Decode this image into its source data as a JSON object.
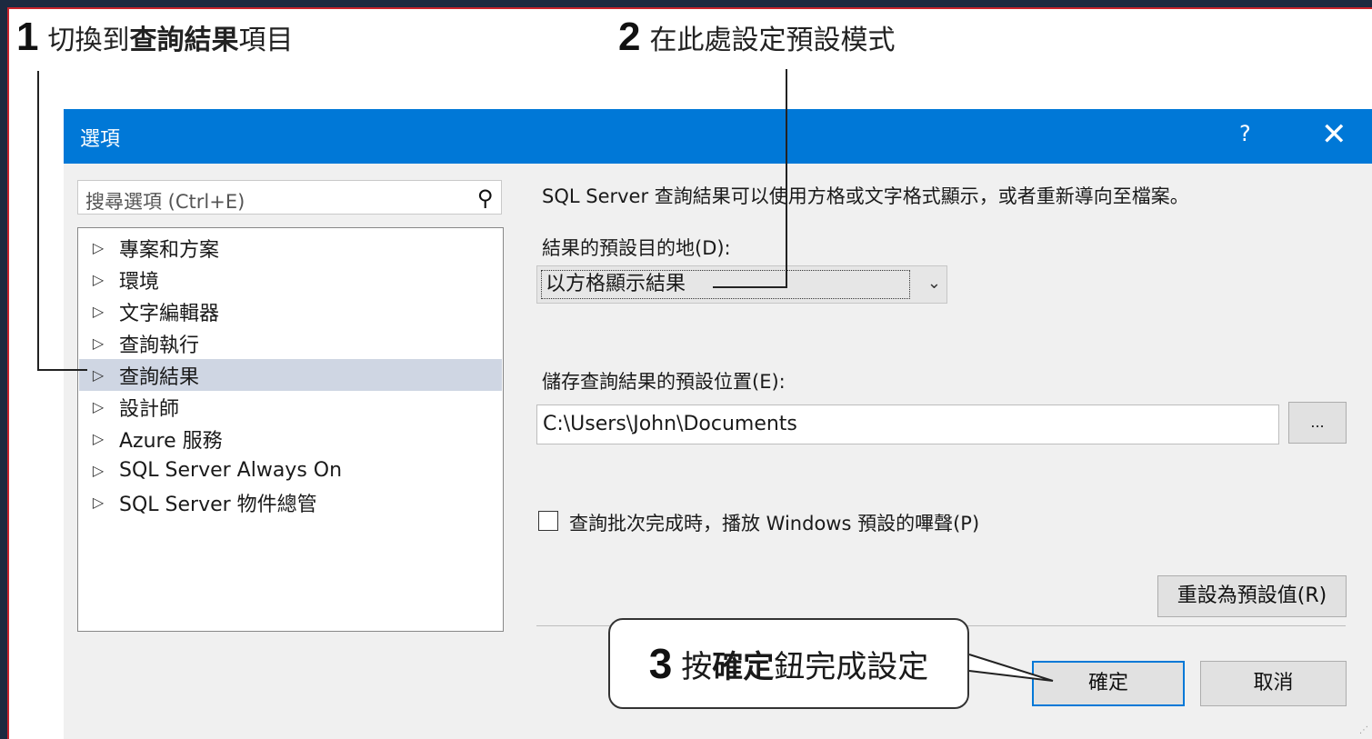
{
  "callouts": {
    "c1": {
      "num": "1",
      "pre": "切換到",
      "bold": "查詢結果",
      "post": "項目"
    },
    "c2": {
      "num": "2",
      "text": "在此處設定預設模式"
    },
    "c3": {
      "num": "3",
      "pre": "按",
      "bold": "確定",
      "post": "鈕完成設定"
    }
  },
  "dialog": {
    "title": "選項",
    "help_label": "?",
    "close_label": "✕",
    "search_placeholder": "搜尋選項 (Ctrl+E)",
    "tree": [
      {
        "label": "專案和方案"
      },
      {
        "label": "環境"
      },
      {
        "label": "文字編輯器"
      },
      {
        "label": "查詢執行"
      },
      {
        "label": "查詢結果",
        "selected": true
      },
      {
        "label": "設計師"
      },
      {
        "label": "Azure 服務"
      },
      {
        "label": "SQL Server Always On"
      },
      {
        "label": "SQL Server 物件總管"
      }
    ],
    "description": "SQL Server 查詢結果可以使用方格或文字格式顯示，或者重新導向至檔案。",
    "destination_label": "結果的預設目的地(D):",
    "destination_value": "以方格顯示結果",
    "location_label": "儲存查詢結果的預設位置(E):",
    "location_value": "C:\\Users\\John\\Documents",
    "browse_label": "...",
    "beep_label": "查詢批次完成時，播放 Windows 預設的嗶聲(P)",
    "beep_checked": false,
    "reset_label": "重設為預設值(R)",
    "ok_label": "確定",
    "cancel_label": "取消"
  }
}
